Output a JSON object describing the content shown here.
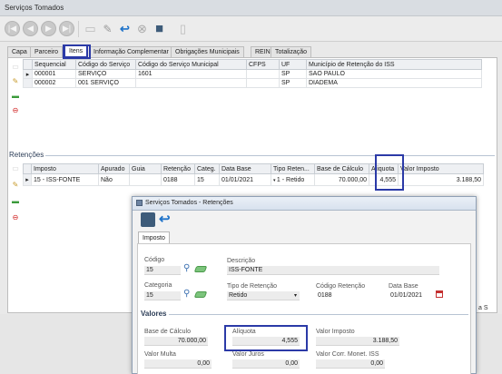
{
  "window": {
    "title": "Serviços Tomados"
  },
  "toolbar": {
    "buttons": [
      {
        "icon": "first-record-icon",
        "glyph": "|◀"
      },
      {
        "icon": "previous-record-icon",
        "glyph": "◀"
      },
      {
        "icon": "next-record-icon",
        "glyph": "▶"
      },
      {
        "icon": "last-record-icon",
        "glyph": "▶|"
      },
      {
        "icon": "new-document-icon",
        "glyph": "▭"
      },
      {
        "icon": "edit-pencil-icon",
        "glyph": "✎"
      },
      {
        "icon": "undo-arrow-icon",
        "glyph": "↩"
      },
      {
        "icon": "cancel-icon",
        "glyph": "⊗"
      },
      {
        "icon": "save-floppy-icon",
        "glyph": "■"
      },
      {
        "icon": "delete-icon",
        "glyph": "▯"
      }
    ]
  },
  "tabs": [
    "Capa",
    "Parceiro",
    "Itens",
    "Informação Complementar",
    "Obrigações Municipais",
    "REINF",
    "Totalização"
  ],
  "active_tab": "Itens",
  "items_grid": {
    "columns": [
      "Sequencial",
      "Código do Serviço",
      "Código do Serviço Municipal",
      "CFPS",
      "UF",
      "Município de Retenção do ISS"
    ],
    "rows": [
      {
        "marker": "▸",
        "seq": "000001",
        "codigo": "SERVIÇO",
        "municipal": "1601",
        "cfps": "",
        "uf": "SP",
        "municipio": "SAO PAULO"
      },
      {
        "marker": "",
        "seq": "000002",
        "codigo": "001 SERVIÇO",
        "municipal": "",
        "cfps": "",
        "uf": "SP",
        "municipio": "DIADEMA"
      }
    ]
  },
  "retencoes": {
    "label": "Retenções",
    "columns": [
      "Imposto",
      "Apurado",
      "Guia",
      "Retenção",
      "Categ.",
      "Data Base",
      "Tipo Reten...",
      "Base de Cálculo",
      "Aliquota",
      "Valor Imposto"
    ],
    "row": {
      "imposto": "15 - ISS-FONTE",
      "apurado": "Não",
      "guia": "",
      "retencao": "0188",
      "categ": "15",
      "data_base": "01/01/2021",
      "tipo": "1 - Retido",
      "base_calculo": "70.000,00",
      "aliquota": "4,555",
      "valor_imposto": "3.188,50"
    }
  },
  "dialog": {
    "title": "Serviços Tomados - Retenções",
    "tab": "Imposto",
    "fields": {
      "codigo_label": "Código",
      "codigo": "15",
      "descricao_label": "Descrição",
      "descricao": "ISS-FONTE",
      "categoria_label": "Categoria",
      "categoria": "15",
      "tipo_label": "Tipo de Retenção",
      "tipo": "Retido",
      "codigo_retencao_label": "Código Retenção",
      "codigo_retencao": "0188",
      "data_base_label": "Data Base",
      "data_base": "01/01/2021"
    },
    "valores": {
      "label": "Valores",
      "base_label": "Base de Cálculo",
      "base": "70.000,00",
      "aliquota_label": "Alíquota",
      "aliquota": "4,555",
      "valor_imposto_label": "Valor Imposto",
      "valor_imposto": "3.188,50",
      "multa_label": "Valor Multa",
      "multa": "0,00",
      "juros_label": "Valor Juros",
      "juros": "0,00",
      "corr_label": "Valor Corr. Monet. ISS",
      "corr": "0,00"
    }
  },
  "partial_text": {
    "right_edge": "a S"
  },
  "colors": {
    "highlight": "#2b3aa7"
  }
}
